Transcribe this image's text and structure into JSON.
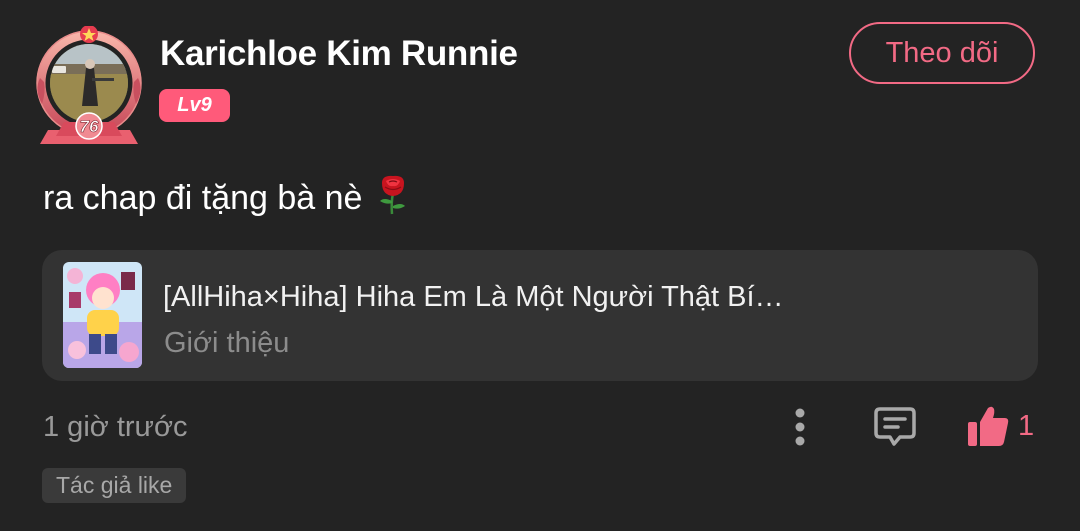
{
  "comment": {
    "user": {
      "name": "Karichloe Kim Runnie",
      "level": "Lv9",
      "frame_number": "76"
    },
    "follow_label": "Theo dõi",
    "text": "ra chap đi tặng bà nè",
    "emoji": "rose-icon",
    "linked_story": {
      "title": "[AllHiha×Hiha] Hiha Em Là Một Người Thật Bí…",
      "subtitle": "Giới thiệu"
    },
    "timestamp": "1 giờ trước",
    "like_count": "1",
    "author_like_tag": "Tác giả like",
    "icons": {
      "more": "more-vertical-icon",
      "reply": "comment-icon",
      "like": "thumbs-up-icon"
    },
    "colors": {
      "background": "#232323",
      "accent": "#f26a85",
      "level_badge": "#ff5a7a",
      "card_background": "#333333",
      "muted_text": "#999999"
    }
  }
}
